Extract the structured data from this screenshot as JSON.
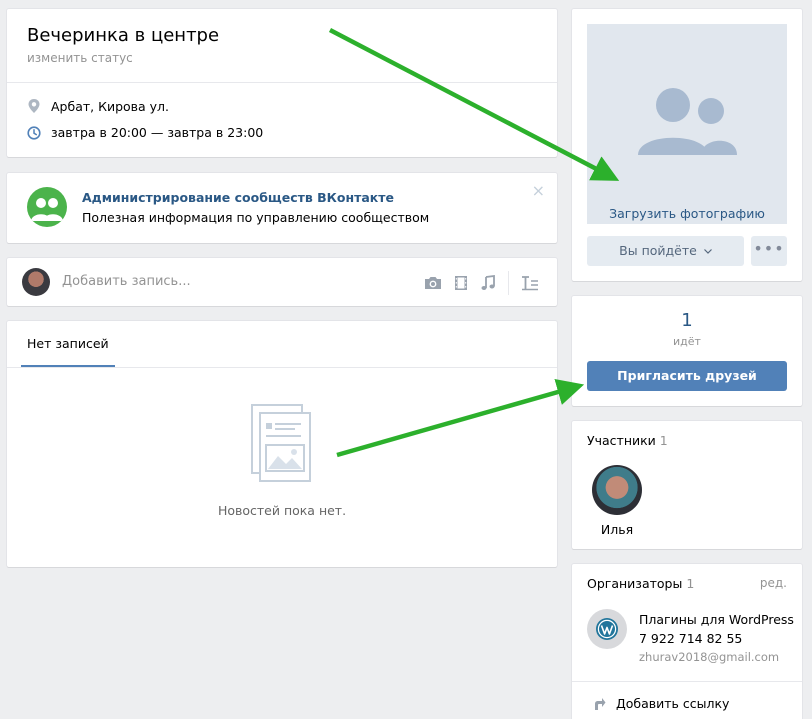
{
  "event": {
    "title": "Вечеринка в центре",
    "status_link": "изменить статус",
    "address": "Арбат, Кирова ул.",
    "time": "завтра в 20:00 — завтра в 23:00"
  },
  "notice": {
    "title": "Администрирование сообществ ВКонтакте",
    "text": "Полезная информация по управлению сообществом",
    "close": "×"
  },
  "composer": {
    "placeholder": "Добавить запись..."
  },
  "posts": {
    "tab_label": "Нет записей",
    "empty_text": "Новостей пока нет."
  },
  "photo": {
    "upload_label": "Загрузить фотографию",
    "going_button": "Вы пойдёте",
    "more_button": "•••"
  },
  "going": {
    "count": "1",
    "label": "идёт",
    "invite_button": "Пригласить друзей"
  },
  "members": {
    "title": "Участники",
    "count": "1",
    "items": [
      {
        "name": "Илья"
      }
    ]
  },
  "organizers": {
    "title": "Организаторы",
    "count": "1",
    "edit": "ред.",
    "name": "Плагины для WordPress",
    "phone": "7 922 714 82 55",
    "email": "zhurav2018@gmail.com",
    "add_link": "Добавить ссылку"
  },
  "colors": {
    "accent": "#5181b8",
    "link": "#2a5885",
    "arrow": "#2cb02c",
    "notice_logo": "#4bb34b"
  }
}
